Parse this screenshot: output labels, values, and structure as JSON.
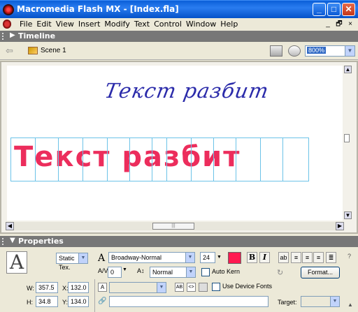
{
  "window": {
    "title": "Macromedia Flash MX - [Index.fla]",
    "minimize_glyph": "_",
    "maximize_glyph": "□",
    "close_glyph": "✕"
  },
  "menubar": {
    "items": [
      "File",
      "Edit",
      "View",
      "Insert",
      "Modify",
      "Text",
      "Control",
      "Window",
      "Help"
    ],
    "doc_minimize": "_",
    "doc_restore": "🗗",
    "doc_close": "×"
  },
  "timeline": {
    "header": "Timeline"
  },
  "scenebar": {
    "back_glyph": "⇦",
    "scene_label": "Scene 1",
    "zoom": "800%"
  },
  "stage": {
    "script_text": "Текст разбит",
    "broken_text": "Текст разбит",
    "letter_count": 13
  },
  "properties": {
    "header": "Properties",
    "tool_glyph": "A",
    "text_type": "Static Tex.",
    "font_glyph": "A",
    "font_name": "Broadway-Normal",
    "font_size": "24",
    "text_color": "#ff1a50",
    "bold": "B",
    "italic": "I",
    "tracking_icon": "A/V",
    "tracking_value": "0",
    "baseline_icon": "A↕",
    "baseline": "Normal",
    "autokern_label": "Auto Kern",
    "format_button": "Format...",
    "w_label": "W:",
    "w_value": "357.5",
    "x_label": "X:",
    "x_value": "132.0",
    "h_label": "H:",
    "h_value": "34.8",
    "y_label": "Y:",
    "y_value": "134.0",
    "line_type_icon": "A",
    "selectable_glyph": "AB",
    "html_glyph": "<>",
    "device_fonts_label": "Use Device Fonts",
    "link_icon": "🔗",
    "target_label": "Target:"
  }
}
